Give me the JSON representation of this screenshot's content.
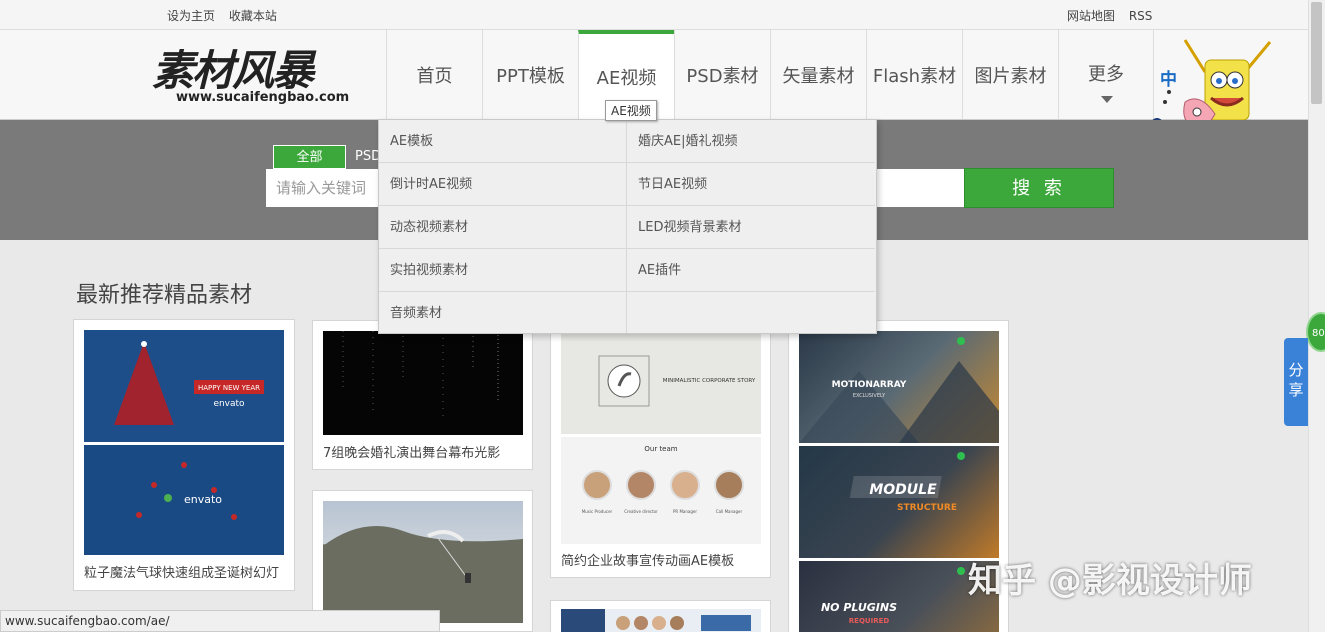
{
  "topbar": {
    "left_links": [
      "设为主页",
      "收藏本站"
    ],
    "right_links": [
      "网站地图",
      "RSS"
    ]
  },
  "logo": {
    "name": "素材风暴",
    "url": "www.sucaifengbao.com"
  },
  "nav": {
    "items": [
      "首页",
      "PPT模板",
      "AE视频",
      "PSD素材",
      "矢量素材",
      "Flash素材",
      "图片素材",
      "更多"
    ],
    "active": "AE视频",
    "tooltip": "AE视频",
    "lang": "中"
  },
  "search": {
    "tab_all": "全部",
    "tab_psd": "PSD",
    "placeholder": "请输入关键词",
    "button": "搜 索"
  },
  "dropdown": {
    "left": [
      "AE模板",
      "倒计时AE视频",
      "动态视频素材",
      "实拍视频素材",
      "音频素材"
    ],
    "right": [
      "婚庆AE|婚礼视频",
      "节日AE视频",
      "LED视频背景素材",
      "AE插件"
    ]
  },
  "section_title": "最新推荐精品素材",
  "cards": [
    {
      "caption": "粒子魔法气球快速组成圣诞树幻灯",
      "thumb_text_top": "HAPPY NEW YEAR",
      "thumb_text_brand": "envato"
    },
    {
      "caption": "7组晚会婚礼演出舞台幕布光影"
    },
    {
      "caption": "简约企业故事宣传动画AE模板",
      "thumb_text_top": "MINIMALISTIC CORPORATE STORY",
      "thumb_text_team": "Our team",
      "team_roles": [
        "Music Producer",
        "Creative director",
        "PR Manager",
        "Call Manager"
      ]
    },
    {
      "caption": "",
      "thumb_texts": [
        "MOTIONARRAY",
        "EXCLUSIVELY",
        "MODULE",
        "STRUCTURE",
        "NO PLUGINS",
        "REQUIRED"
      ]
    }
  ],
  "share": "分享",
  "badge": "80",
  "statusbar": "www.sucaifengbao.com/ae/",
  "watermark": "知乎 @影视设计师",
  "colors": {
    "accent": "#3ca83c",
    "band": "#7a7a7a",
    "share": "#3a82d8"
  }
}
